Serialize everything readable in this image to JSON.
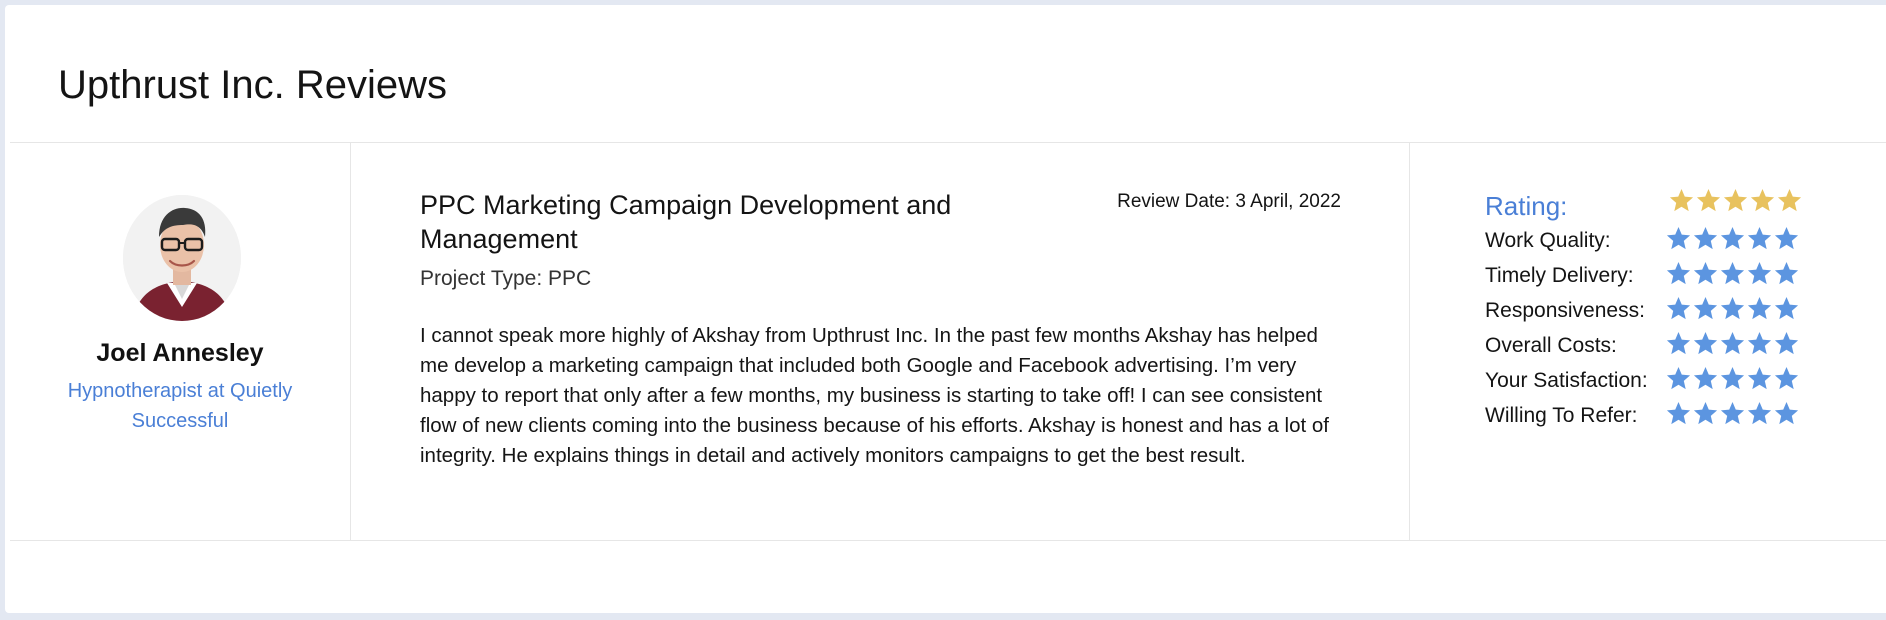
{
  "page": {
    "title": "Upthrust Inc. Reviews"
  },
  "reviewer": {
    "name": "Joel Annesley",
    "title": "Hypnotherapist at Quietly Successful",
    "avatar_icon": "person-avatar"
  },
  "review": {
    "headline": "PPC Marketing Campaign Development and Management",
    "date": "Review Date: 3 April, 2022",
    "project_type": "Project Type: PPC",
    "body": "I cannot speak more highly of Akshay from Upthrust Inc. In the past few months Akshay has helped me develop a marketing campaign that included both Google and Facebook advertising. I’m very happy to report that only after a few months, my business is starting to take off! I can see consistent flow of new clients coming into the business because of his efforts. Akshay is honest and has a lot of integrity. He explains things in detail and actively monitors campaigns to get the best result."
  },
  "ratings": {
    "heading": "Rating:",
    "overall_stars": 5,
    "overall_color": "#e8c25e",
    "category_color": "#5c95e0",
    "items": [
      {
        "label": "Work Quality:",
        "stars": 5
      },
      {
        "label": "Timely Delivery:",
        "stars": 5
      },
      {
        "label": "Responsiveness:",
        "stars": 5
      },
      {
        "label": "Overall Costs:",
        "stars": 5
      },
      {
        "label": "Your Satisfaction:",
        "stars": 5
      },
      {
        "label": "Willing To Refer:",
        "stars": 5
      }
    ]
  }
}
